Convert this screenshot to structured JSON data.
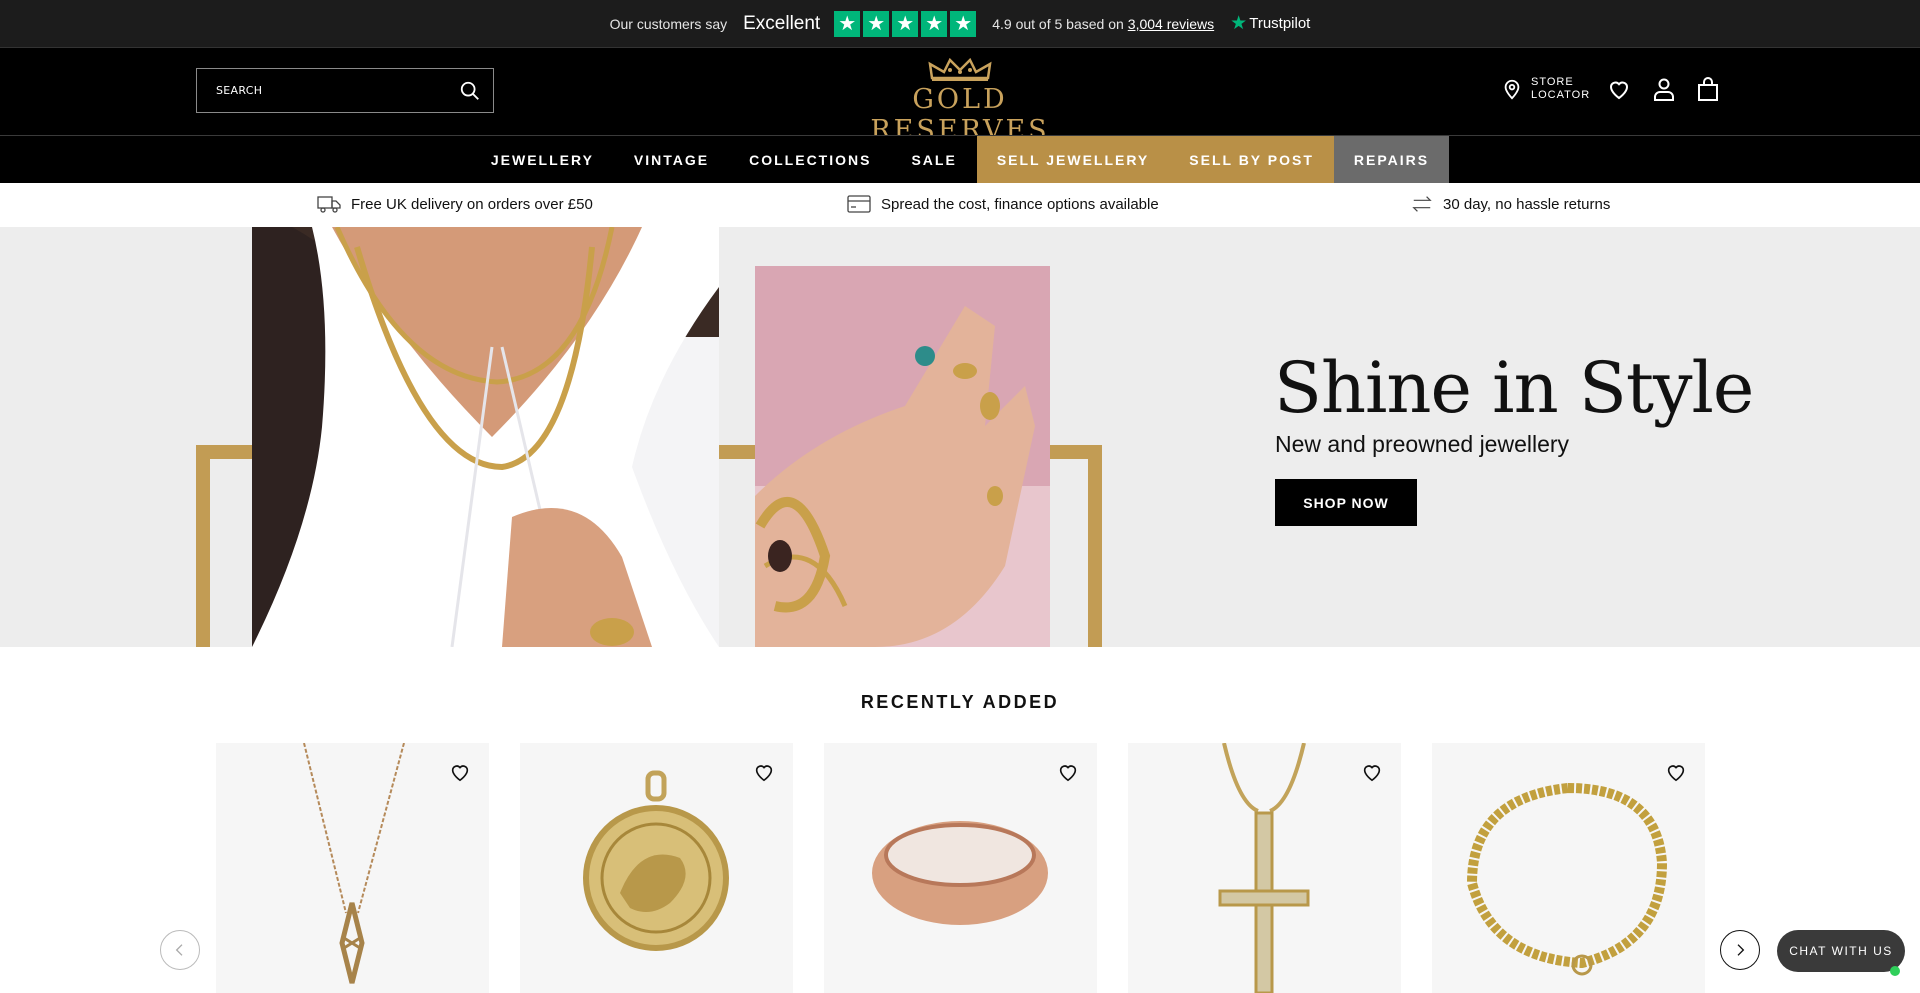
{
  "trustpilot": {
    "customers_say": "Our customers say",
    "verdict": "Excellent",
    "rating_text": "4.9 out of 5 based on",
    "reviews_link": "3,004 reviews",
    "brand": "Trustpilot",
    "star_count": 5,
    "color": "#00b67a"
  },
  "header": {
    "search_placeholder": "SEARCH",
    "logo_text": "GOLD RESERVES",
    "store_locator": "STORE LOCATOR"
  },
  "nav": {
    "items": [
      {
        "label": "JEWELLERY"
      },
      {
        "label": "VINTAGE"
      },
      {
        "label": "COLLECTIONS"
      },
      {
        "label": "SALE"
      },
      {
        "label": "SELL JEWELLERY"
      },
      {
        "label": "SELL BY POST"
      },
      {
        "label": "REPAIRS"
      }
    ]
  },
  "usp": {
    "delivery": "Free UK delivery on orders over £50",
    "finance": "Spread the cost, finance options available",
    "returns": "30 day, no hassle returns"
  },
  "hero": {
    "title": "Shine in Style",
    "subtitle": "New and preowned jewellery",
    "cta": "SHOP NOW"
  },
  "recently_added": {
    "title": "RECENTLY ADDED"
  },
  "chat": {
    "label": "CHAT WITH US"
  },
  "colors": {
    "gold": "#c29c54",
    "nav_gold": "#b99047",
    "nav_grey": "#6b6b6b"
  }
}
